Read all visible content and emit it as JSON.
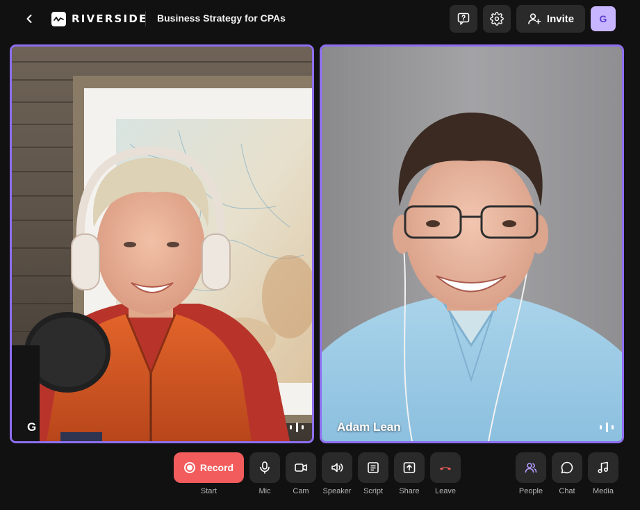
{
  "header": {
    "brand": "RIVERSIDE",
    "title": "Business Strategy for CPAs",
    "invite_label": "Invite",
    "avatar_initial": "G"
  },
  "tiles": [
    {
      "name": "G"
    },
    {
      "name": "Adam Lean"
    }
  ],
  "toolbar": {
    "record_label": "Record",
    "start_label": "Start",
    "mic_label": "Mic",
    "cam_label": "Cam",
    "speaker_label": "Speaker",
    "script_label": "Script",
    "share_label": "Share",
    "leave_label": "Leave",
    "people_label": "People",
    "chat_label": "Chat",
    "media_label": "Media"
  },
  "icons": {
    "back": "chevron-left-icon",
    "help": "help-chat-icon",
    "settings": "gear-icon",
    "invite": "add-user-icon",
    "mic": "mic-icon",
    "cam": "camera-icon",
    "speaker": "speaker-icon",
    "script": "script-icon",
    "share": "share-screen-icon",
    "leave": "hang-up-icon",
    "people": "people-icon",
    "chat": "chat-icon",
    "media": "music-icon"
  },
  "colors": {
    "background": "#111111",
    "accent": "#8e6ff2",
    "record": "#f25c5c",
    "leave": "#f25c5c",
    "avatar_bg": "#c8b5ff",
    "button_bg": "#2a2a2a"
  }
}
